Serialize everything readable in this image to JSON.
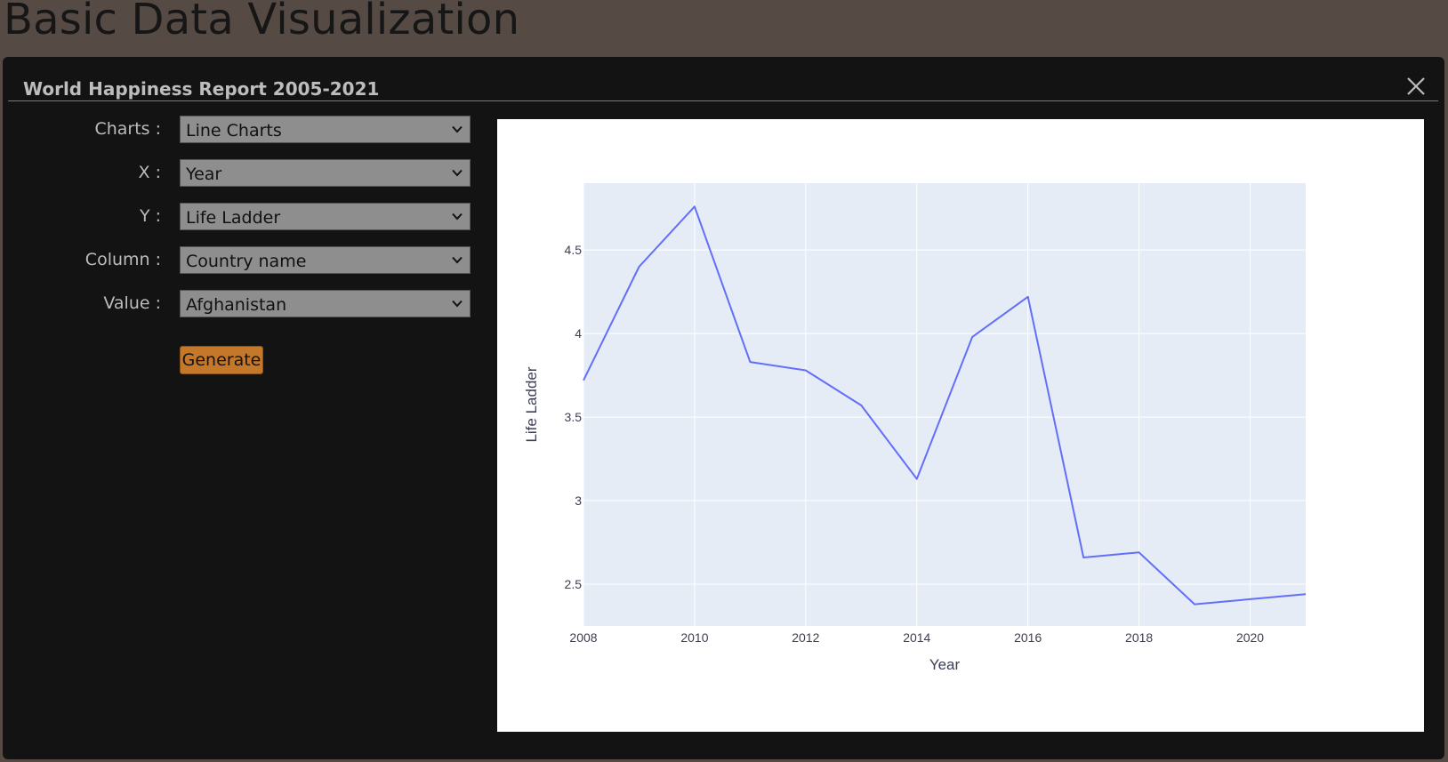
{
  "page": {
    "title": "Basic Data Visualization"
  },
  "modal": {
    "title": "World Happiness Report 2005-2021"
  },
  "form": {
    "fields": [
      {
        "label": "Charts :",
        "value": "Line Charts"
      },
      {
        "label": "X :",
        "value": "Year"
      },
      {
        "label": "Y :",
        "value": "Life Ladder"
      },
      {
        "label": "Column :",
        "value": "Country name"
      },
      {
        "label": "Value :",
        "value": "Afghanistan"
      }
    ],
    "generate_label": "Generate"
  },
  "colors": {
    "background": "#564b44",
    "modal": "#131313",
    "button": "#c5782a",
    "plot_bg": "#e5ecf6",
    "line": "#636efa"
  },
  "chart_data": {
    "type": "line",
    "xlabel": "Year",
    "ylabel": "Life Ladder",
    "xlim": [
      2008,
      2021
    ],
    "ylim": [
      2.25,
      4.9
    ],
    "x_ticks": [
      2008,
      2010,
      2012,
      2014,
      2016,
      2018,
      2020
    ],
    "y_ticks": [
      2.5,
      3,
      3.5,
      4,
      4.5
    ],
    "y_tick_labels": [
      "2.5",
      "3",
      "3.5",
      "4",
      "4.5"
    ],
    "grid": true,
    "series": [
      {
        "x": [
          2008,
          2009,
          2010,
          2011,
          2012,
          2013,
          2014,
          2015,
          2016,
          2017,
          2018,
          2019,
          2020,
          2021
        ],
        "y": [
          3.72,
          4.4,
          4.76,
          3.83,
          3.78,
          3.57,
          3.13,
          3.98,
          4.22,
          2.66,
          2.69,
          2.38,
          2.41,
          2.44
        ]
      }
    ]
  }
}
